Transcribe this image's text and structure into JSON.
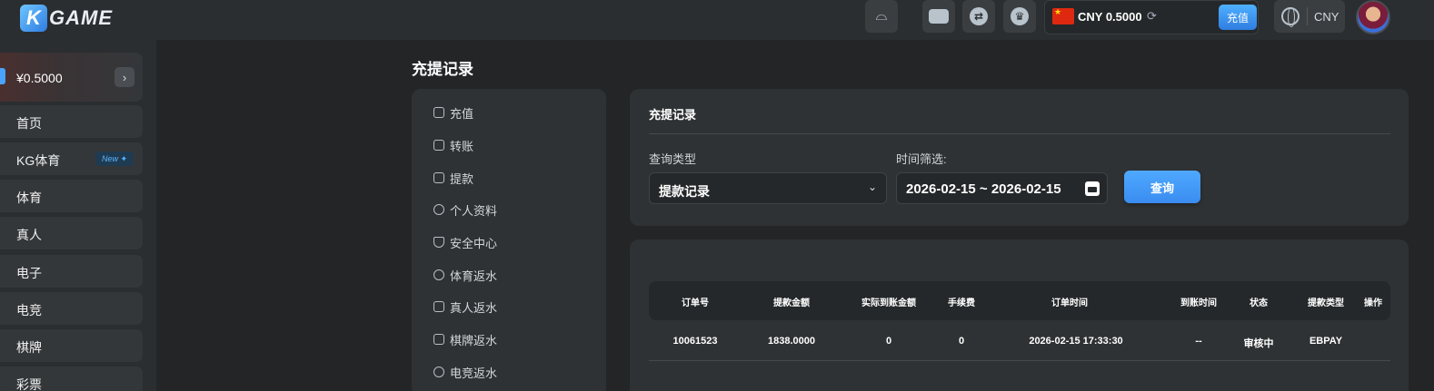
{
  "header": {
    "logo_letter": "K",
    "logo_text": "GAME",
    "wallet_amount": "CNY 0.5000",
    "deposit_label": "充值",
    "currency_label": "CNY"
  },
  "sidebar": {
    "balance": "¥0.5000",
    "items": [
      {
        "label": "首页"
      },
      {
        "label": "KG体育",
        "badge": "New"
      },
      {
        "label": "体育"
      },
      {
        "label": "真人"
      },
      {
        "label": "电子"
      },
      {
        "label": "电竞"
      },
      {
        "label": "棋牌"
      },
      {
        "label": "彩票"
      }
    ]
  },
  "page": {
    "title": "充提记录"
  },
  "submenu": {
    "items": [
      {
        "label": "充值",
        "icon": "piggy-bank-icon"
      },
      {
        "label": "转账",
        "icon": "transfer-icon"
      },
      {
        "label": "提款",
        "icon": "withdraw-icon"
      },
      {
        "label": "个人资料",
        "icon": "user-icon"
      },
      {
        "label": "安全中心",
        "icon": "shield-icon"
      },
      {
        "label": "体育返水",
        "icon": "soccer-ball-icon"
      },
      {
        "label": "真人返水",
        "icon": "live-casino-icon"
      },
      {
        "label": "棋牌返水",
        "icon": "cards-icon"
      },
      {
        "label": "电竞返水",
        "icon": "gamepad-icon"
      }
    ]
  },
  "query": {
    "title": "充提记录",
    "type_label": "查询类型",
    "type_value": "提款记录",
    "time_label": "时间筛选:",
    "date_range": "2026-02-15 ~ 2026-02-15",
    "query_button": "查询"
  },
  "table": {
    "headers": [
      "订单号",
      "提款金额",
      "实际到账金额",
      "手续费",
      "订单时间",
      "到账时间",
      "状态",
      "提款类型",
      "操作"
    ],
    "rows": [
      [
        "10061523",
        "1838.0000",
        "0",
        "0",
        "2026-02-15 17:33:30",
        "--",
        "审核中",
        "EBPAY",
        ""
      ]
    ]
  },
  "colors": {
    "accent": "#3a8cf0",
    "background": "#232527",
    "panel": "#2f3234"
  }
}
